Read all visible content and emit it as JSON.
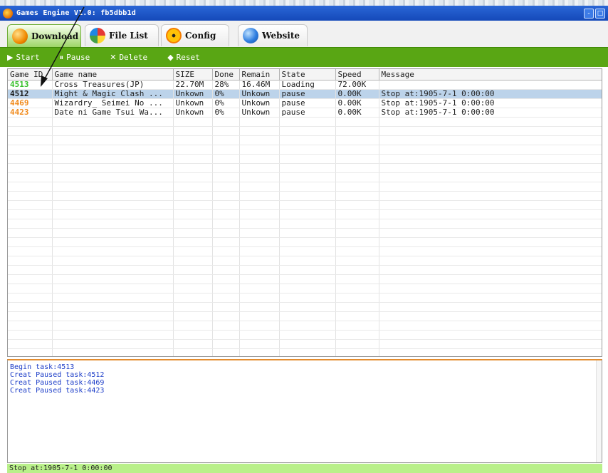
{
  "window": {
    "title": "Games Engine V1.0: fb5dbb1d",
    "controls": [
      "-",
      "□"
    ]
  },
  "tabs": [
    {
      "label": "Download",
      "icon": "download-icon",
      "active": true
    },
    {
      "label": "File List",
      "icon": "file-list-icon",
      "active": false
    },
    {
      "label": "Config",
      "icon": "config-icon",
      "active": false
    },
    {
      "label": "Website",
      "icon": "website-icon",
      "active": false
    }
  ],
  "toolbar": {
    "start": {
      "icon": "▶",
      "label": "Start"
    },
    "pause": {
      "icon": "⏸",
      "label": "Pause"
    },
    "delete": {
      "icon": "✕",
      "label": "Delete"
    },
    "reset": {
      "icon": "◆",
      "label": "Reset"
    }
  },
  "table": {
    "columns": [
      "Game ID",
      "Game name",
      "SIZE",
      "Done",
      "Remain",
      "State",
      "Speed",
      "Message"
    ],
    "rows": [
      {
        "id": "4513",
        "name": "Cross Treasures(JP)",
        "size": "22.70M",
        "done": "28%",
        "remain": "16.46M",
        "state": "Loading",
        "speed": "72.00K",
        "message": "",
        "id_color": "#35c02a",
        "selected": false
      },
      {
        "id": "4512",
        "name": "Might & Magic Clash ...",
        "size": "Unkown",
        "done": "0%",
        "remain": "Unkown",
        "state": "pause",
        "speed": "0.00K",
        "message": "Stop at:1905-7-1 0:00:00",
        "id_color": "#1a1a1a",
        "selected": true
      },
      {
        "id": "4469",
        "name": "Wizardry_ Seimei No ...",
        "size": "Unkown",
        "done": "0%",
        "remain": "Unkown",
        "state": "pause",
        "speed": "0.00K",
        "message": "Stop at:1905-7-1 0:00:00",
        "id_color": "#f08a1c",
        "selected": false
      },
      {
        "id": "4423",
        "name": "Date ni Game Tsui Wa...",
        "size": "Unkown",
        "done": "0%",
        "remain": "Unkown",
        "state": "pause",
        "speed": "0.00K",
        "message": "Stop at:1905-7-1 0:00:00",
        "id_color": "#f08a1c",
        "selected": false
      }
    ]
  },
  "log": {
    "lines": [
      "Begin task:4513",
      "Creat Paused task:4512",
      "Creat Paused task:4469",
      "Creat Paused task:4423"
    ]
  },
  "status": {
    "text": "Stop at:1905-7-1 0:00:00"
  },
  "colors": {
    "accent_green": "#59a614",
    "titlebar_blue": "#1a52c4",
    "log_text": "#1b3cc8",
    "status_bg": "#b9f08a"
  }
}
